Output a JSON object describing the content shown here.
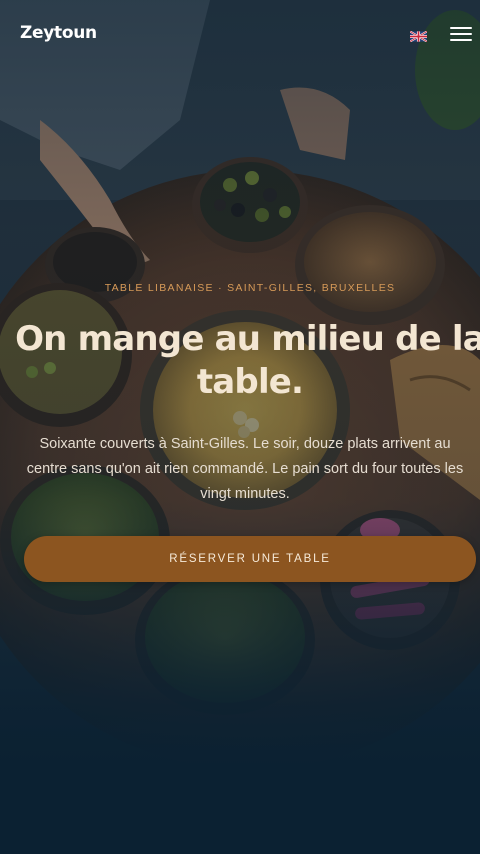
{
  "header": {
    "logo_text": "Zeytoun",
    "language_flag": "uk-flag-icon",
    "menu_icon": "hamburger-icon"
  },
  "hero": {
    "eyebrow": "TABLE LIBANAISE · SAINT-GILLES, BRUXELLES",
    "headline": "On mange au milieu de la table.",
    "lede": "Soixante couverts à Saint-Gilles. Le soir, douze plats arrivent au centre sans qu'on ait rien commandé. Le pain sort du four toutes les vingt minutes.",
    "cta_label": "RÉSERVER UNE TABLE",
    "background_image": "mezze-table-photo"
  },
  "colors": {
    "background": "#0b2132",
    "accent": "#8c5520",
    "eyebrow": "#d69a58",
    "headline": "#f3e6d2",
    "body_text": "#e6ddd1"
  }
}
